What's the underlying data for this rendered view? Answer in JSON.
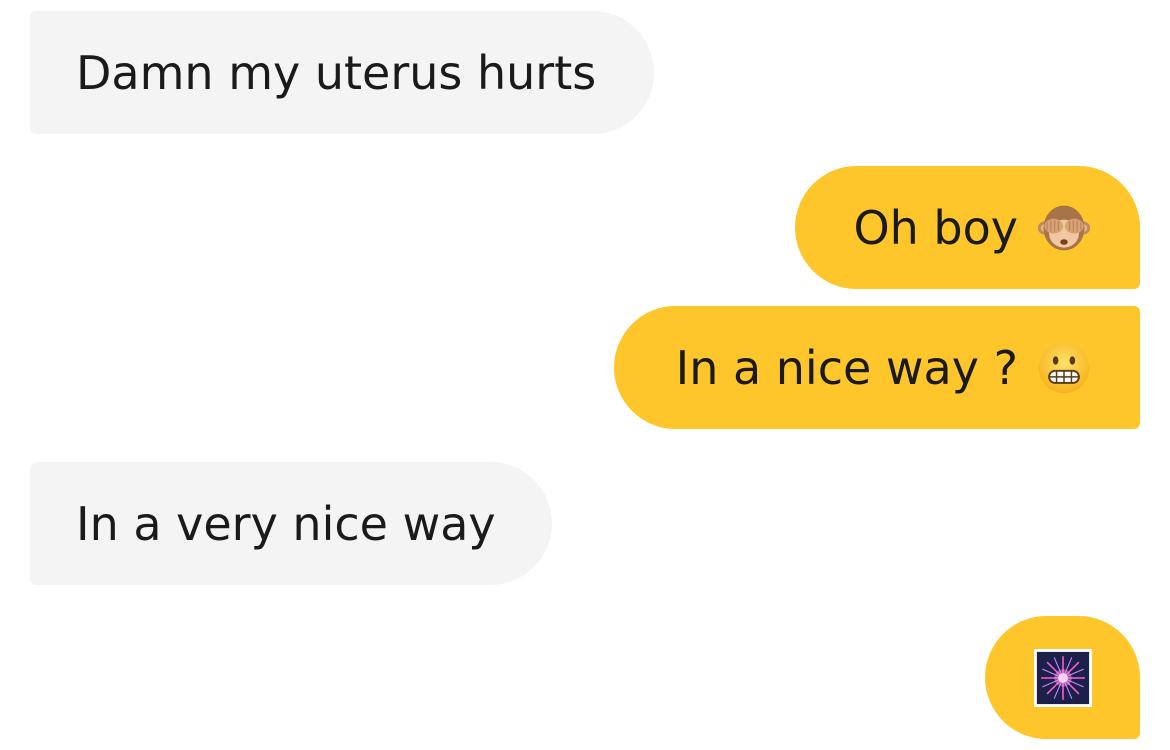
{
  "messages": [
    {
      "id": "m1",
      "direction": "incoming",
      "text": "Damn my uterus hurts"
    },
    {
      "id": "m2",
      "direction": "outgoing",
      "text": "Oh boy",
      "emoji": "see-no-evil-monkey-icon"
    },
    {
      "id": "m3",
      "direction": "outgoing",
      "text": "In a nice way ?",
      "emoji": "grimacing-face-icon"
    },
    {
      "id": "m4",
      "direction": "incoming",
      "text": "In a very nice way"
    },
    {
      "id": "m5",
      "direction": "outgoing",
      "text": "",
      "emoji": "fireworks-icon"
    }
  ],
  "colors": {
    "incoming_bubble": "#f4f4f4",
    "outgoing_bubble": "#ffc62b",
    "text": "#1a1a1a",
    "background": "#ffffff"
  }
}
